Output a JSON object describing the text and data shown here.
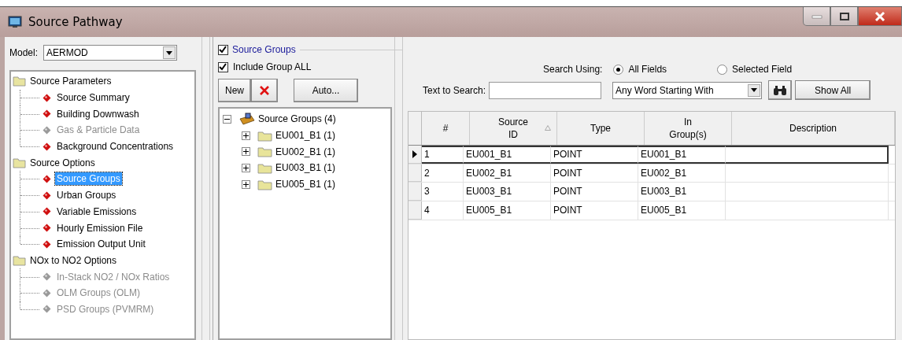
{
  "window": {
    "title": "Source Pathway"
  },
  "model": {
    "label": "Model:",
    "value": "AERMOD"
  },
  "nav_tree": [
    {
      "label": "Source Parameters",
      "children": [
        {
          "label": "Source Summary",
          "disabled": false,
          "selected": false
        },
        {
          "label": "Building Downwash",
          "disabled": false,
          "selected": false
        },
        {
          "label": "Gas & Particle Data",
          "disabled": true,
          "selected": false
        },
        {
          "label": "Background Concentrations",
          "disabled": false,
          "selected": false
        }
      ]
    },
    {
      "label": "Source Options",
      "children": [
        {
          "label": "Source Groups",
          "disabled": false,
          "selected": true
        },
        {
          "label": "Urban Groups",
          "disabled": false,
          "selected": false
        },
        {
          "label": "Variable Emissions",
          "disabled": false,
          "selected": false
        },
        {
          "label": "Hourly Emission File",
          "disabled": false,
          "selected": false
        },
        {
          "label": "Emission Output Unit",
          "disabled": false,
          "selected": false
        }
      ]
    },
    {
      "label": "NOx to NO2 Options",
      "children": [
        {
          "label": "In-Stack NO2 / NOx Ratios",
          "disabled": true,
          "selected": false
        },
        {
          "label": "OLM Groups (OLM)",
          "disabled": true,
          "selected": false
        },
        {
          "label": "PSD Groups (PVMRM)",
          "disabled": true,
          "selected": false
        }
      ]
    }
  ],
  "source_groups": {
    "label": "Source Groups",
    "checked": true,
    "include_all": {
      "label": "Include Group ALL",
      "checked": true
    },
    "new_button": "New",
    "auto_button": "Auto...",
    "tree": {
      "label": "Source Groups (4)",
      "expanded": true,
      "children": [
        {
          "label": "EU001_B1 (1)",
          "expanded": false
        },
        {
          "label": "EU002_B1 (1)",
          "expanded": false
        },
        {
          "label": "EU003_B1 (1)",
          "expanded": false
        },
        {
          "label": "EU005_B1 (1)",
          "expanded": false
        }
      ]
    }
  },
  "search": {
    "label": "Search Using:",
    "options": [
      {
        "label": "All Fields",
        "selected": true
      },
      {
        "label": "Selected Field",
        "selected": false
      }
    ],
    "text_label": "Text to Search:",
    "mode": "Any Word Starting With",
    "show_all": "Show All"
  },
  "table": {
    "columns": [
      {
        "label": "#",
        "sorted": false
      },
      {
        "label": "Source ID",
        "sorted": true
      },
      {
        "label": "Type",
        "sorted": false
      },
      {
        "label": "In Group(s)",
        "sorted": false
      },
      {
        "label": "Description",
        "sorted": false
      }
    ],
    "rows": [
      {
        "cells": [
          "1",
          "EU001_B1",
          "POINT",
          "EU001_B1"
        ],
        "selected": true
      },
      {
        "cells": [
          "2",
          "EU002_B1",
          "POINT",
          "EU002_B1"
        ],
        "selected": false
      },
      {
        "cells": [
          "3",
          "EU003_B1",
          "POINT",
          "EU003_B1"
        ],
        "selected": false
      },
      {
        "cells": [
          "4",
          "EU005_B1",
          "POINT",
          "EU005_B1"
        ],
        "selected": false
      }
    ]
  }
}
